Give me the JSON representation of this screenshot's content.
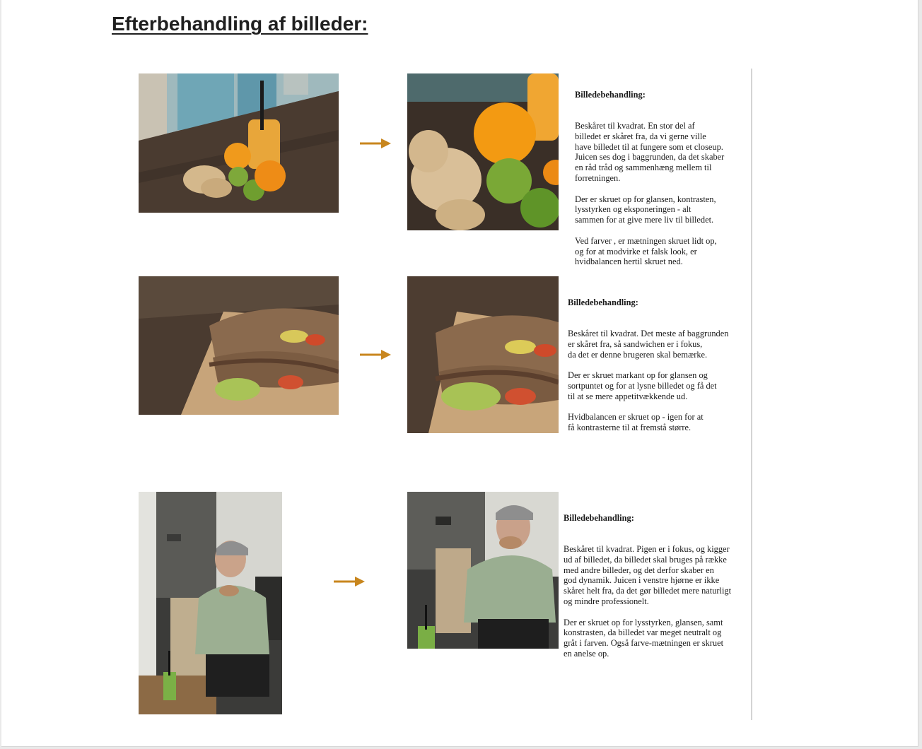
{
  "page": {
    "title": "Efterbehandling af billeder:"
  },
  "rows": [
    {
      "before_alt": "Ingefær, appelsiner, lime og juice på træbord",
      "after_alt": "Beskåret closeup af ingefær, appelsin og lime",
      "arrow_icon": "arrow-right-icon",
      "heading": "Billedebehandling:",
      "text": "Beskåret til kvadrat. En stor del af\nbilledet er skåret fra, da vi gerne ville\nhave billedet til at fungere som et closeup.\nJuicen ses dog i baggrunden, da det skaber\nen råd tråd og sammenhæng mellem til\nforretningen.\n\nDer er skruet op for glansen, kontrasten,\nlysstyrken og eksponeringen - alt\nsammen for at give mere liv til billedet.\n\nVed farver , er mætningen skruet lidt op,\nog for at modvirke et falsk look, er\nhvidbalancen hertil skruet ned."
    },
    {
      "before_alt": "Sandwich med avocado på madpapir",
      "after_alt": "Beskåret sandwich i fokus",
      "arrow_icon": "arrow-right-icon",
      "heading": "Billedebehandling:",
      "text": "Beskåret til kvadrat. Det meste af baggrunden\ner skåret fra, så sandwichen er i fokus,\nda det er denne brugeren skal bemærke.\n\nDer er skruet markant op for glansen og\nsortpuntet og for at lysne billedet og få det\ntil at se mere appetitvækkende ud.\n\nHvidbalancen er skruet op - igen for at\nfå kontrasterne til at fremstå større."
    },
    {
      "before_alt": "Pige spiser sandwich på en stol",
      "after_alt": "Beskåret billede af pigen der spiser",
      "arrow_icon": "arrow-right-icon",
      "heading": "Billedebehandling:",
      "text": "Beskåret til kvadrat. Pigen er i fokus, og kigger\nud af billedet, da billedet skal bruges på række\nmed andre billeder, og det derfor skaber en\ngod dynamik. Juicen i venstre hjørne er ikke\nskåret helt fra, da det gør billedet mere naturligt\nog mindre professionelt.\n\nDer er skruet op for lysstyrken, glansen, samt\nkonstrasten, da billedet var meget neutralt og\ngråt i farven. Også farve-mætningen er skruet\nen anelse op."
    }
  ],
  "colors": {
    "arrow": "#c8861e",
    "divider": "#d4d4d4"
  }
}
